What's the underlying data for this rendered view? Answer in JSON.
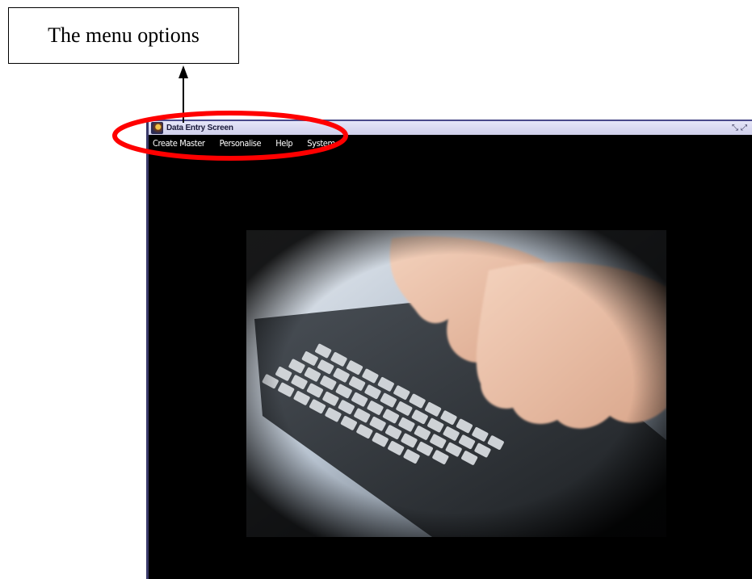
{
  "annotation": {
    "callout_text": "The menu options"
  },
  "window": {
    "title": "Data Entry Screen",
    "icon": "app-icon",
    "controls": [
      "restore-icon",
      "maximize-icon"
    ]
  },
  "menu": {
    "items": [
      {
        "label": "Create Master"
      },
      {
        "label": "Personalise"
      },
      {
        "label": "Help"
      },
      {
        "label": "System"
      }
    ]
  },
  "colors": {
    "highlight": "#ff0000",
    "titlebar": "#d8d8f0",
    "workspace": "#000000"
  }
}
